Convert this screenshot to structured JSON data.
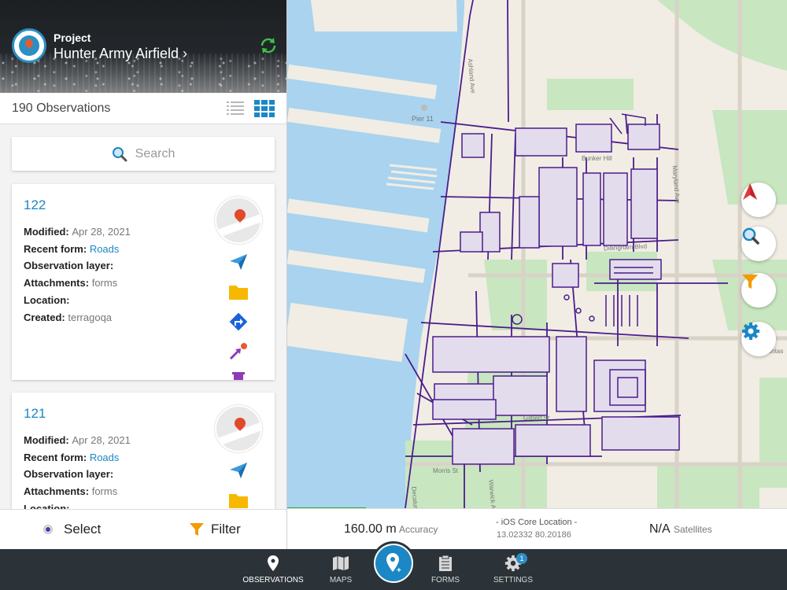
{
  "project": {
    "kicker": "Project",
    "name": "Hunter Army Airfield ›"
  },
  "observations": {
    "count_label": "190 Observations"
  },
  "search": {
    "placeholder": "Search"
  },
  "cards": [
    {
      "id": "122",
      "modified_label": "Modified:",
      "modified": "Apr 28, 2021",
      "recent_form_label": "Recent form:",
      "recent_form": "Roads",
      "layer_label": "Observation layer:",
      "attachments_label": "Attachments:",
      "attachments": "forms",
      "location_label": "Location:",
      "created_label": "Created:",
      "created": "terragoqa"
    },
    {
      "id": "121",
      "modified_label": "Modified:",
      "modified": "Apr 28, 2021",
      "recent_form_label": "Recent form:",
      "recent_form": "Roads",
      "layer_label": "Observation layer:",
      "attachments_label": "Attachments:",
      "attachments": "forms",
      "location_label": "Location:"
    }
  ],
  "footer": {
    "select": "Select",
    "filter": "Filter"
  },
  "map": {
    "labels": {
      "pier": "Pier 11",
      "bunker": "Bunker Hill",
      "ashland": "Ashland Ave",
      "maryland": "Maryland Ave",
      "dillingham": "Dillingham Blvd",
      "pocahontas": "Pocahontas",
      "gilbert": "Gilbert St",
      "morris": "Morris St",
      "decatur": "Decatur",
      "warwick": "Warwick Ave"
    }
  },
  "status": {
    "accuracy_value": "160.00 m",
    "accuracy_label": "Accuracy",
    "location_title": "- iOS Core Location -",
    "coords": "13.02332 80.20186",
    "satellites_value": "N/A",
    "satellites_label": "Satellites"
  },
  "tabs": [
    {
      "label": "OBSERVATIONS",
      "icon": "pin-icon",
      "active": true
    },
    {
      "label": "MAPS",
      "icon": "map-icon"
    },
    {
      "label": "FORMS",
      "icon": "clipboard-icon"
    },
    {
      "label": "SETTINGS",
      "icon": "gear-icon",
      "badge": "1"
    }
  ],
  "colors": {
    "accent": "#1b87c5",
    "overlay": "#4b1d8c",
    "water": "#a9d3ee",
    "park": "#c8e6c0",
    "land": "#f1ede4"
  }
}
